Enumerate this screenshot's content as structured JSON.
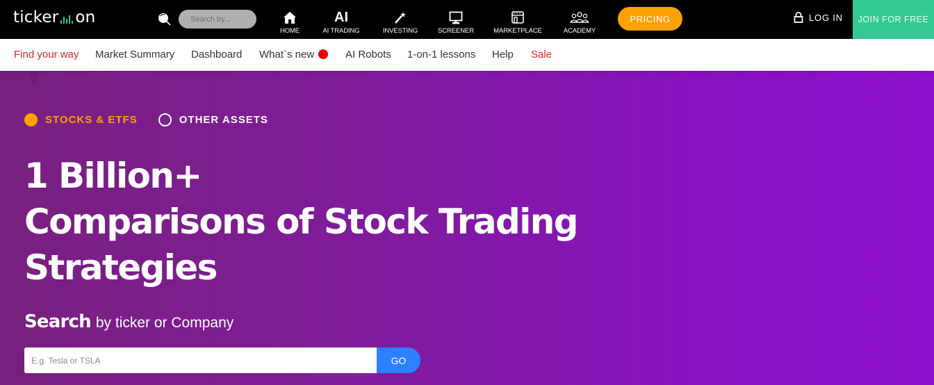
{
  "header": {
    "logo_left": "ticker",
    "logo_right": "on",
    "search_placeholder": "Search by...",
    "nav": [
      {
        "label": "HOME",
        "icon": "home-icon"
      },
      {
        "label": "AI TRADING",
        "icon": "ai-text-icon",
        "icon_text": "AI"
      },
      {
        "label": "INVESTING",
        "icon": "magic-wand-icon"
      },
      {
        "label": "SCREENER",
        "icon": "monitor-icon"
      },
      {
        "label": "MARKETPLACE",
        "icon": "store-icon"
      },
      {
        "label": "ACADEMY",
        "icon": "people-group-icon"
      }
    ],
    "pricing_label": "PRICING",
    "login_label": "LOG IN",
    "join_label": "JOIN FOR FREE"
  },
  "subnav": {
    "items": [
      {
        "label": "Find your way",
        "highlight": true
      },
      {
        "label": "Market Summary"
      },
      {
        "label": "Dashboard"
      },
      {
        "label": "What`s new",
        "badge": "red-dot"
      },
      {
        "label": "AI Robots"
      },
      {
        "label": "1-on-1 lessons"
      },
      {
        "label": "Help"
      },
      {
        "label": "Sale",
        "highlight": true
      }
    ]
  },
  "hero": {
    "asset_options": [
      {
        "label": "STOCKS & ETFS",
        "selected": true
      },
      {
        "label": "OTHER ASSETS",
        "selected": false
      }
    ],
    "headline_lines": [
      "1 Billion+",
      "Comparisons of Stock Trading",
      "Strategies"
    ],
    "search_label_bold": "Search",
    "search_label_rest": "by ticker or Company",
    "search_placeholder": "E.g. Tesla or TSLA",
    "go_label": "GO"
  },
  "colors": {
    "accent_orange": "#ffa101",
    "join_green": "#33c991",
    "go_blue": "#2d80ff",
    "hero_purple": "#8a12c8",
    "link_red": "#d4281f"
  }
}
